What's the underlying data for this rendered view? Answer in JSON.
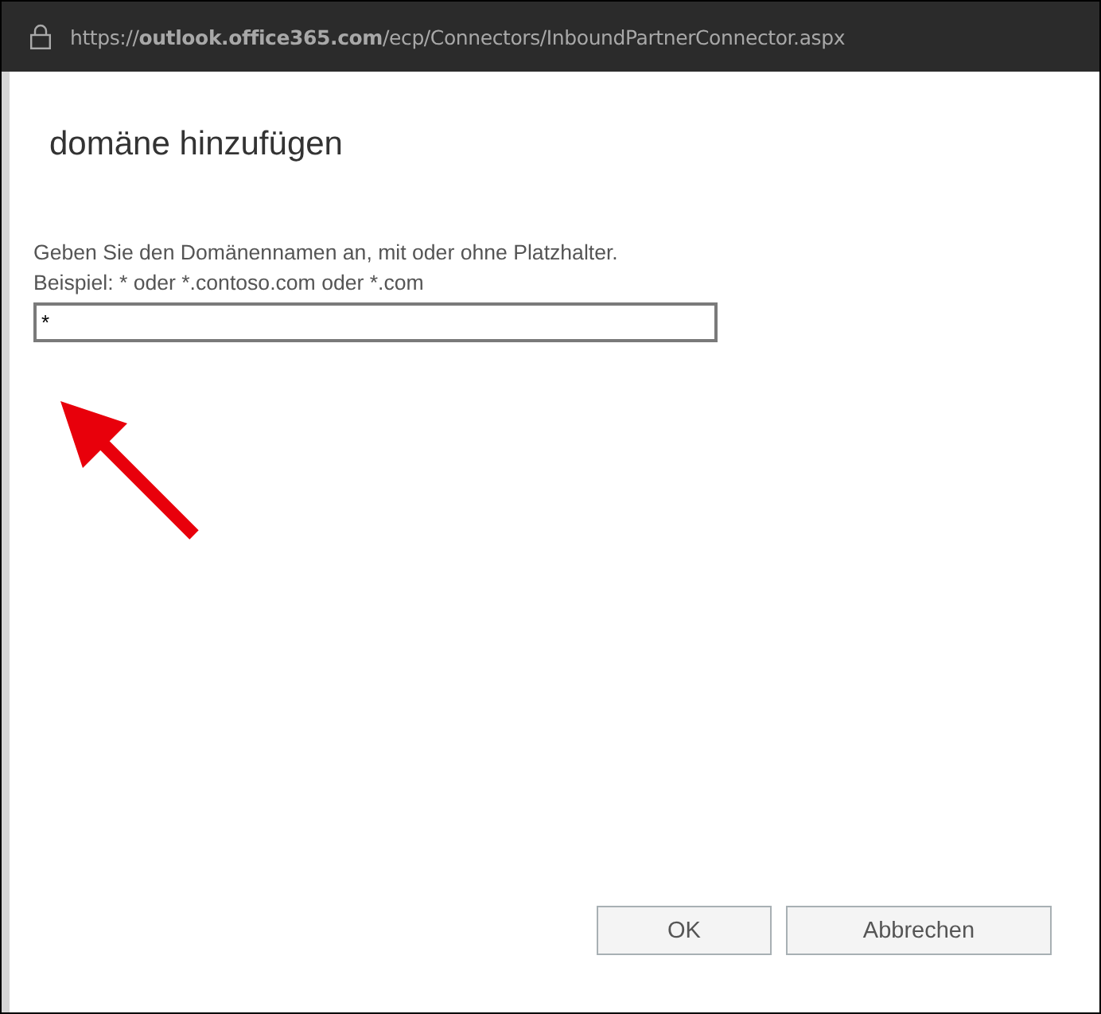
{
  "address_bar": {
    "url": "https://**outlook.office365.com**/ecp/Connectors/InboundPartnerConnector.aspx"
  },
  "dialog": {
    "title": "domäne hinzufügen",
    "instructions": [
      "Geben Sie den Domänennamen an, mit oder ohne Platzhalter.",
      "Beispiel: * oder *.contoso.com oder *.com"
    ],
    "domain_field": {
      "value": "*"
    },
    "buttons": [
      {
        "label": "OK"
      },
      {
        "label": "Abbrechen"
      }
    ]
  }
}
